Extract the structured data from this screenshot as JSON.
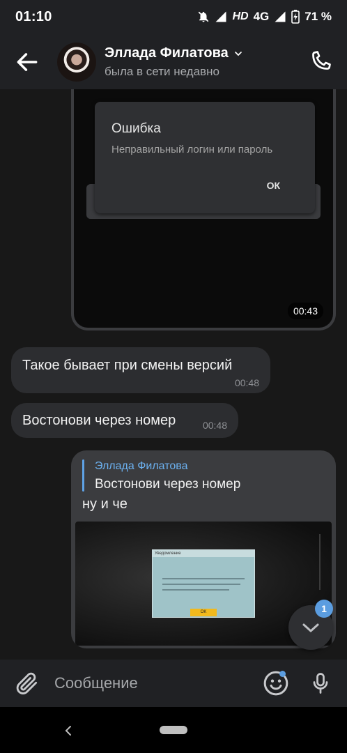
{
  "status_bar": {
    "time": "01:10",
    "network_hd": "HD",
    "network_type": "4G",
    "battery_percent": "71 %"
  },
  "header": {
    "contact_name": "Эллада Филатова",
    "contact_status": "была в сети недавно"
  },
  "messages": {
    "video": {
      "dialog_title": "Ошибка",
      "dialog_text": "Неправильный логин или пароль",
      "dialog_ok": "ОК",
      "duration": "00:43"
    },
    "incoming_1": {
      "text": "Такое бывает при смены версий",
      "time": "00:48"
    },
    "incoming_2": {
      "text": "Востонови через номер",
      "time": "00:48"
    },
    "outgoing": {
      "reply_author": "Эллада Филатова",
      "reply_text": "Востонови через номер",
      "text": "ну и че",
      "image": {
        "dialog_header": "Уведомление",
        "ok_label": "OK"
      }
    }
  },
  "scroll_down": {
    "unread_count": "1"
  },
  "composer": {
    "placeholder": "Сообщение"
  },
  "colors": {
    "accent": "#5b9de0",
    "background": "#181818",
    "bar": "#202124",
    "bubble_in": "#2c2d30",
    "bubble_out": "#3b3c3f"
  }
}
